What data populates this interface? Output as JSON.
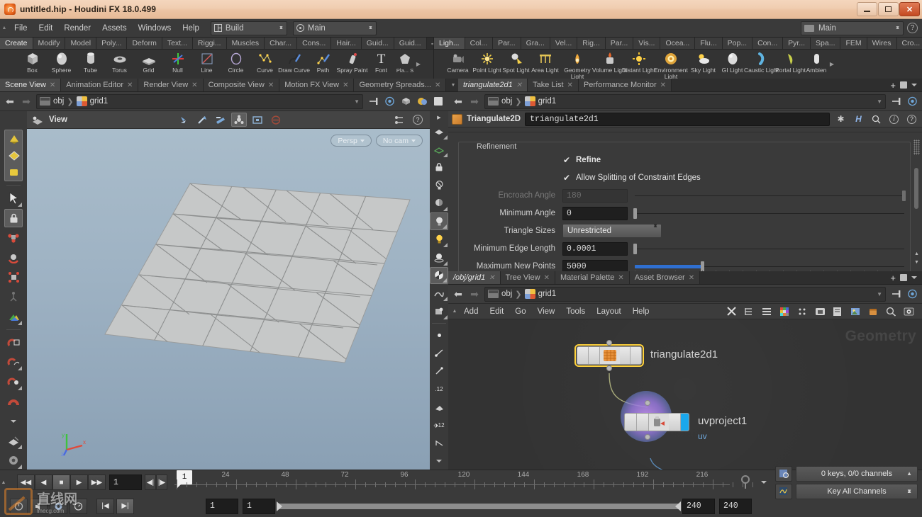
{
  "window": {
    "title": "untitled.hip - Houdini FX 18.0.499",
    "app_icon": "houdini-logo-icon",
    "minimize": "—",
    "maximize": "□",
    "close": "✕"
  },
  "menubar": {
    "items": [
      "File",
      "Edit",
      "Render",
      "Assets",
      "Windows",
      "Help"
    ],
    "build_selector": {
      "label": "Build",
      "icon": "layout-icon"
    },
    "main_selector": {
      "label": "Main",
      "icon": "target-icon"
    },
    "desktop_selector": {
      "label": "Main",
      "icon": "film-icon"
    },
    "help_icon": "question-icon"
  },
  "shelf_left": {
    "tabs": [
      "Create",
      "Modify",
      "Model",
      "Poly...",
      "Deform",
      "Text...",
      "Riggi...",
      "Muscles",
      "Char...",
      "Cons...",
      "Hair...",
      "Guid...",
      "Guid..."
    ],
    "active_tab": "Create",
    "add_label": "+",
    "tools": [
      {
        "label": "Box",
        "icon": "box-icon"
      },
      {
        "label": "Sphere",
        "icon": "sphere-icon"
      },
      {
        "label": "Tube",
        "icon": "tube-icon"
      },
      {
        "label": "Torus",
        "icon": "torus-icon"
      },
      {
        "label": "Grid",
        "icon": "grid-icon"
      },
      {
        "label": "Null",
        "icon": "null-icon"
      },
      {
        "label": "Line",
        "icon": "line-icon"
      },
      {
        "label": "Circle",
        "icon": "circle-icon"
      },
      {
        "label": "Curve",
        "icon": "curve-icon"
      },
      {
        "label": "Draw Curve",
        "icon": "draw-curve-icon"
      },
      {
        "label": "Path",
        "icon": "path-icon"
      },
      {
        "label": "Spray Paint",
        "icon": "spray-paint-icon"
      },
      {
        "label": "Font",
        "icon": "font-icon"
      },
      {
        "label": "Pla... S",
        "icon": "platonic-solids-icon"
      }
    ]
  },
  "shelf_right": {
    "tabs": [
      "Ligh...",
      "Col...",
      "Par...",
      "Gra...",
      "Vel...",
      "Rig...",
      "Par...",
      "Vis...",
      "Ocea...",
      "Flu...",
      "Pop...",
      "Con...",
      "Pyr...",
      "Spa...",
      "FEM",
      "Wires",
      "Cro..."
    ],
    "active_tab": "Ligh...",
    "add_label": "+",
    "tools": [
      {
        "label": "Camera",
        "icon": "camera-icon"
      },
      {
        "label": "Point Light",
        "icon": "point-light-icon"
      },
      {
        "label": "Spot Light",
        "icon": "spot-light-icon"
      },
      {
        "label": "Area Light",
        "icon": "area-light-icon"
      },
      {
        "label": "Geometry Light",
        "icon": "geometry-light-icon"
      },
      {
        "label": "Volume Light",
        "icon": "volume-light-icon"
      },
      {
        "label": "Distant Light",
        "icon": "distant-light-icon"
      },
      {
        "label": "Environment Light",
        "icon": "environment-light-icon"
      },
      {
        "label": "Sky Light",
        "icon": "sky-light-icon"
      },
      {
        "label": "GI Light",
        "icon": "gi-light-icon"
      },
      {
        "label": "Caustic Light",
        "icon": "caustic-light-icon"
      },
      {
        "label": "Portal Light",
        "icon": "portal-light-icon"
      },
      {
        "label": "Ambien",
        "icon": "ambient-light-icon"
      }
    ]
  },
  "scene_pane": {
    "tabs": [
      "Scene View",
      "Animation Editor",
      "Render View",
      "Composite View",
      "Motion FX View",
      "Geometry Spreads..."
    ],
    "active_tab": "Scene View",
    "add_label": "+",
    "path": {
      "obj": "obj",
      "node": "grid1"
    },
    "viewport": {
      "title": "View",
      "persp_chip": "Persp",
      "cam_chip": "No cam",
      "axis_x": "x",
      "axis_y": "y",
      "axis_z": "z"
    }
  },
  "param_pane": {
    "tabs": [
      "triangulate2d1",
      "Take List",
      "Performance Monitor"
    ],
    "active_tab": "triangulate2d1",
    "add_label": "+",
    "path": {
      "obj": "obj",
      "node": "grid1"
    },
    "node_type_label": "Triangulate2D",
    "node_name": "triangulate2d1",
    "header_icons": [
      "gear-icon",
      "houdini-h-icon",
      "search-icon",
      "info-icon",
      "help-icon"
    ],
    "section_title": "Refinement",
    "params": [
      {
        "kind": "checkbox",
        "label": "Refine",
        "checked": true,
        "bold": true
      },
      {
        "kind": "checkbox",
        "label": "Allow Splitting of Constraint Edges",
        "checked": true,
        "bold": false
      },
      {
        "kind": "field",
        "label": "Encroach Angle",
        "value": "180",
        "disabled": true,
        "slider": "right"
      },
      {
        "kind": "field",
        "label": "Minimum Angle",
        "value": "0",
        "disabled": false,
        "slider": "left"
      },
      {
        "kind": "menu",
        "label": "Triangle Sizes",
        "value": "Unrestricted"
      },
      {
        "kind": "field",
        "label": "Minimum Edge Length",
        "value": "0.0001",
        "disabled": false,
        "slider": "left"
      },
      {
        "kind": "field",
        "label": "Maximum New Points",
        "value": "5000",
        "disabled": false,
        "slider": "fill"
      }
    ]
  },
  "network_pane": {
    "tabs": [
      "/obj/grid1",
      "Tree View",
      "Material Palette",
      "Asset Browser"
    ],
    "active_tab": "/obj/grid1",
    "add_label": "+",
    "path": {
      "obj": "obj",
      "node": "grid1"
    },
    "menu": [
      "Add",
      "Edit",
      "Go",
      "View",
      "Tools",
      "Layout",
      "Help"
    ],
    "menu_icons": [
      "tools-icon",
      "list-tree-icon",
      "list-icon",
      "color-palette-icon",
      "dots-grid-icon",
      "snapshot-icon",
      "notes-icon",
      "add-image-icon",
      "box-package-icon",
      "search-icon",
      "preview-icon"
    ],
    "watermark": "Geometry",
    "nodes": [
      {
        "name": "triangulate2d1",
        "selected": true,
        "icon": "triangulate-icon",
        "flag_color": ""
      },
      {
        "name": "uvproject1",
        "selected": false,
        "icon": "uvproject-icon",
        "flag_color": "#1aa7ec",
        "badge": "uv"
      }
    ]
  },
  "playbar": {
    "transport": [
      "jump-start-icon",
      "play-reverse-icon",
      "stop-icon",
      "play-icon",
      "jump-end-icon"
    ],
    "current_frame": "1",
    "step_back": "◀|",
    "step_fwd": "|▶",
    "ruler_ticks": [
      "24",
      "48",
      "72",
      "96",
      "120",
      "144",
      "168",
      "192",
      "216"
    ],
    "frame_marker": "1",
    "range_start": "1",
    "range_start2": "1",
    "range_end": "240",
    "range_end2": "240",
    "keys_status": "0 keys, 0/0 channels",
    "key_mode": "Key All Channels"
  }
}
